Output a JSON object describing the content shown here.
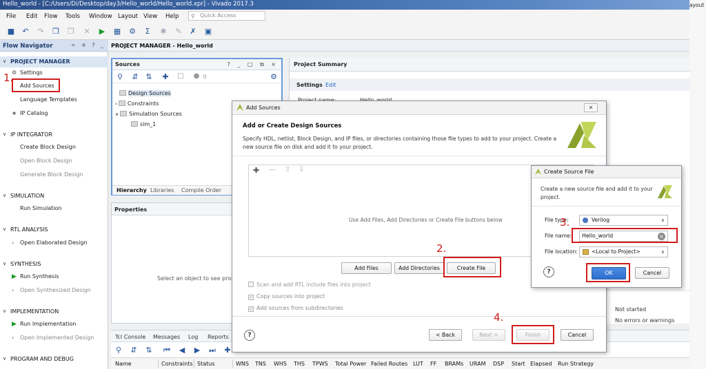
{
  "window": {
    "title": "Hello_world - [C:/Users/Di/Desktop/day3/Hello_world/Hello_world.xpr] - Vivado 2017.3",
    "layout_label": "ayout"
  },
  "menubar": {
    "items": [
      "File",
      "Edit",
      "Flow",
      "Tools",
      "Window",
      "Layout",
      "View",
      "Help"
    ],
    "quick_access_placeholder": "Quick Access"
  },
  "flow_navigator": {
    "title": "Flow Navigator",
    "header_controls": "÷ ≑ ? _",
    "sections": {
      "project_manager": {
        "label": "PROJECT MANAGER",
        "items": [
          "Settings",
          "Add Sources",
          "Language Templates",
          "IP Catalog"
        ]
      },
      "ip_integrator": {
        "label": "IP INTEGRATOR",
        "items": [
          "Create Block Design",
          "Open Block Design",
          "Generate Block Design"
        ]
      },
      "simulation": {
        "label": "SIMULATION",
        "items": [
          "Run Simulation"
        ]
      },
      "rtl_analysis": {
        "label": "RTL ANALYSIS",
        "items": [
          "Open Elaborated Design"
        ]
      },
      "synthesis": {
        "label": "SYNTHESIS",
        "items": [
          "Run Synthesis",
          "Open Synthesized Design"
        ]
      },
      "implementation": {
        "label": "IMPLEMENTATION",
        "items": [
          "Run Implementation",
          "Open Implemented Design"
        ]
      },
      "program_debug": {
        "label": "PROGRAM AND DEBUG"
      }
    }
  },
  "steps": [
    "1.",
    "2.",
    "3.",
    "4."
  ],
  "main": {
    "header": "PROJECT MANAGER - Hello_world",
    "sources": {
      "title": "Sources",
      "controls": "? _ □ ⧉ ×",
      "count": "0",
      "tree": [
        "Design Sources",
        "Constraints",
        "Simulation Sources",
        "sim_1"
      ],
      "tabs": [
        "Hierarchy",
        "Libraries",
        "Compile Order"
      ]
    },
    "properties": {
      "title": "Properties",
      "message": "Select an object to see properti"
    },
    "summary": {
      "title": "Project Summary",
      "settings_label": "Settings",
      "edit_link": "Edit",
      "project_name_label": "Project name:",
      "project_name_value": "Hello_world",
      "status_not_started": "Not started",
      "status_no_errors": "No errors or warnings"
    },
    "tcl": {
      "tabs": [
        "Tcl Console",
        "Messages",
        "Log",
        "Reports"
      ],
      "columns": [
        "Name",
        "Constraints",
        "Status",
        "WNS",
        "TNS",
        "WHS",
        "THS",
        "TPWS",
        "Total Power",
        "Failed Routes",
        "LUT",
        "FF",
        "BRAMs",
        "URAM",
        "DSP",
        "Start",
        "Elapsed",
        "Run Strategy"
      ]
    }
  },
  "add_sources_dialog": {
    "title": "Add Sources",
    "heading": "Add or Create Design Sources",
    "description": "Specify HDL, netlist, Block Design, and IP files, or directories containing those file types to add to your project. Create a new source file on disk and add it to your project.",
    "empty_message": "Use Add Files, Add Directories or Create File buttons below",
    "buttons": {
      "add_files": "Add Files",
      "add_directories": "Add Directories",
      "create_file": "Create File"
    },
    "options": {
      "scan_rtl": "Scan and add RTL include files into project",
      "copy_sources": "Copy sources into project",
      "add_subdirs": "Add sources from subdirectories"
    },
    "nav": {
      "back": "< Back",
      "next": "Next >",
      "finish": "Finish",
      "cancel": "Cancel"
    },
    "help": "?"
  },
  "create_source_dialog": {
    "title": "Create Source File",
    "description": "Create a new source file and add it to your project.",
    "file_type_label": "File type:",
    "file_type_value": "Verilog",
    "file_name_label": "File name:",
    "file_name_value": "Hello_world",
    "file_location_label": "File location:",
    "file_location_value": "<Local to Project>",
    "ok": "OK",
    "cancel": "Cancel",
    "help": "?"
  },
  "colors": {
    "annotation_red": "#d11b1b",
    "ok_blue": "#2f6fcf",
    "run_green": "#1a9a2a",
    "xilinx_logo": "#9fb53a"
  }
}
